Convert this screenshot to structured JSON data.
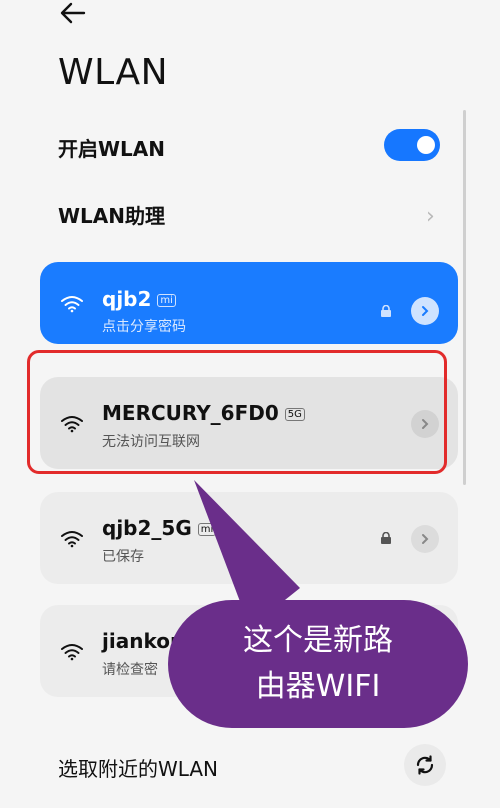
{
  "header": {
    "title": "WLAN"
  },
  "settings": {
    "enable_wlan_label": "开启WLAN",
    "assistant_label": "WLAN助理"
  },
  "networks": [
    {
      "ssid": "qjb2",
      "tag": "mi",
      "status": "点击分享密码",
      "locked": true,
      "connected": true
    },
    {
      "ssid": "MERCURY_6FD0",
      "tag": "5G",
      "status": "无法访问互联网",
      "locked": false,
      "connected": false
    },
    {
      "ssid": "qjb2_5G",
      "tag": "mi",
      "status": "已保存",
      "locked": true,
      "connected": false
    },
    {
      "ssid": "jiankon",
      "tag": "",
      "status": "请检查密",
      "locked": false,
      "connected": false
    }
  ],
  "annotation": {
    "line1": "这个是新路",
    "line2": "由器WIFI"
  },
  "footer": {
    "nearby_label": "选取附近的WLAN"
  },
  "colors": {
    "accent": "#1677ff",
    "highlight": "#e22b2b",
    "bubble": "#6a2e8a"
  }
}
